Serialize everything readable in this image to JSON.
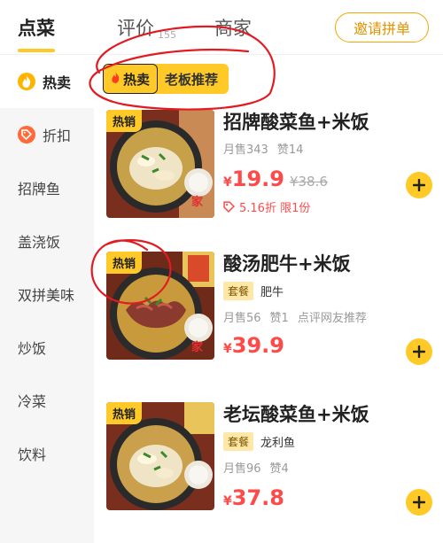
{
  "header": {
    "tabs": [
      {
        "label": "点菜"
      },
      {
        "label": "评价",
        "count": "155"
      },
      {
        "label": "商家"
      }
    ],
    "invite_label": "邀请拼单"
  },
  "sidebar": {
    "items": [
      {
        "label": "热卖",
        "icon": "flame-icon"
      },
      {
        "label": "折扣",
        "icon": "discount-icon"
      },
      {
        "label": "招牌鱼"
      },
      {
        "label": "盖浇饭"
      },
      {
        "label": "双拼美味"
      },
      {
        "label": "炒饭"
      },
      {
        "label": "冷菜"
      },
      {
        "label": "饮料"
      }
    ]
  },
  "section": {
    "hot_label": "热卖",
    "rec_label": "老板推荐"
  },
  "dishes": [
    {
      "tag": "热销",
      "name": "招牌酸菜鱼+米饭",
      "sales": "月售343",
      "likes": "赞14",
      "currency": "¥",
      "price": "19.9",
      "orig_price": "¥38.6",
      "promo": "5.16折  限1份"
    },
    {
      "tag": "热销",
      "name": "酸汤肥牛+米饭",
      "combo": "套餐",
      "combo_text": "肥牛",
      "sales": "月售56",
      "likes": "赞1",
      "extra": "点评网友推荐",
      "currency": "¥",
      "price": "39.9"
    },
    {
      "tag": "热销",
      "name": "老坛酸菜鱼+米饭",
      "combo": "套餐",
      "combo_text": "龙利鱼",
      "sales": "月售96",
      "likes": "赞4",
      "currency": "¥",
      "price": "37.8"
    }
  ],
  "colors": {
    "accent": "#ffc928",
    "price": "#ff4a4a",
    "invite_border": "#f3a600",
    "annotation": "#e21b23"
  }
}
